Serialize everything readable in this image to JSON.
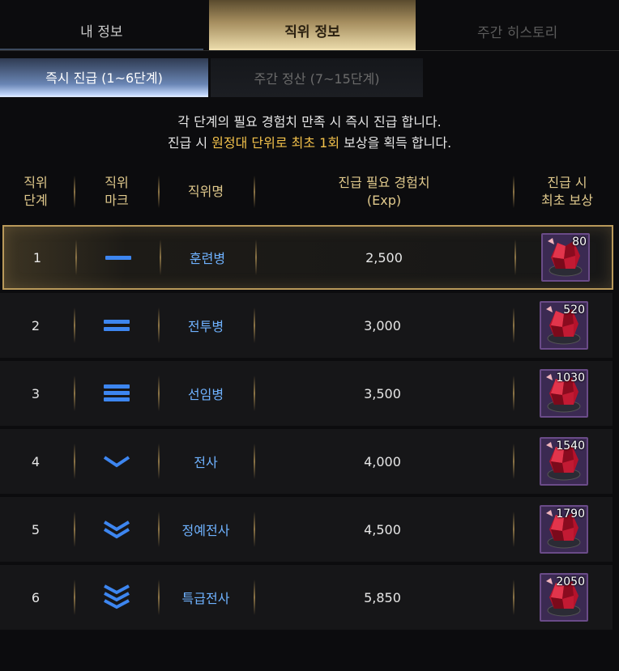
{
  "tabs": [
    {
      "label": "내 정보"
    },
    {
      "label": "직위 정보"
    },
    {
      "label": "주간 히스토리"
    }
  ],
  "subtabs": [
    {
      "label": "즉시 진급 (1~6단계)"
    },
    {
      "label": "주간 정산 (7~15단계)"
    }
  ],
  "notice": {
    "line1": "각 단계의 필요 경험치 만족 시 즉시 진급 합니다.",
    "line2_prefix": "진급 시 ",
    "line2_highlight": "원정대 단위로 최초 1회",
    "line2_suffix": " 보상을 획득 합니다."
  },
  "headers": {
    "rank_step": "직위\n단계",
    "rank_mark": "직위\n마크",
    "rank_name": "직위명",
    "exp": "진급 필요 경험치\n(Exp)",
    "reward": "진급 시\n최초 보상"
  },
  "rows": [
    {
      "step": "1",
      "mark": "bar-1",
      "name": "훈련병",
      "exp": "2,500",
      "reward_count": "80"
    },
    {
      "step": "2",
      "mark": "bar-2",
      "name": "전투병",
      "exp": "3,000",
      "reward_count": "520"
    },
    {
      "step": "3",
      "mark": "bar-3",
      "name": "선임병",
      "exp": "3,500",
      "reward_count": "1030"
    },
    {
      "step": "4",
      "mark": "chevron-1",
      "name": "전사",
      "exp": "4,000",
      "reward_count": "1540"
    },
    {
      "step": "5",
      "mark": "chevron-2",
      "name": "정예전사",
      "exp": "4,500",
      "reward_count": "1790"
    },
    {
      "step": "6",
      "mark": "chevron-3",
      "name": "특급전사",
      "exp": "5,850",
      "reward_count": "2050"
    }
  ],
  "colors": {
    "accent_gold": "#e0c98c",
    "rank_name_blue": "#6fb2ff",
    "highlight_yellow": "#f2c14b",
    "reward_bg": "#3b2a52"
  },
  "icons": {
    "reward": "red-crystal-icon"
  }
}
